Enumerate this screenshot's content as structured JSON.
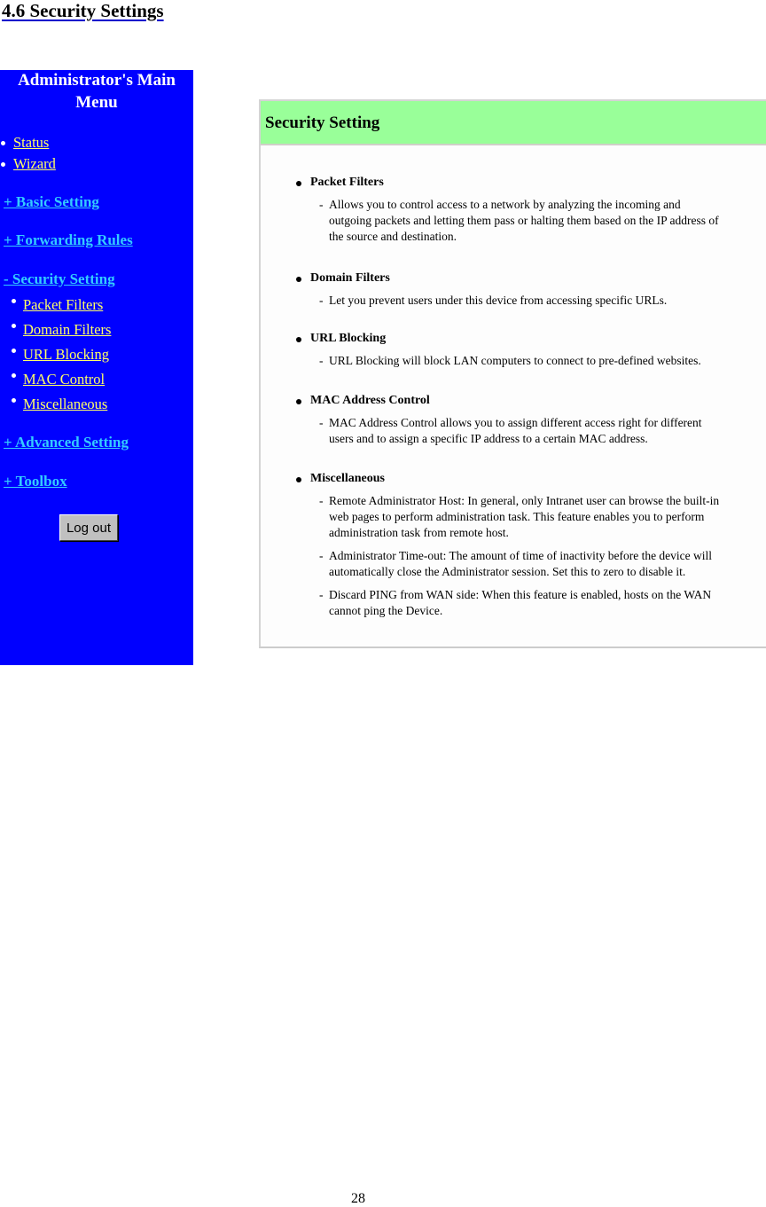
{
  "document": {
    "heading": "4.6 Security Settings",
    "page_number": "28"
  },
  "sidebar": {
    "title_line1": "Administrator's Main",
    "title_line2": "Menu",
    "top_links": [
      {
        "label": "Status"
      },
      {
        "label": "Wizard"
      }
    ],
    "groups": [
      {
        "label": "+ Basic Setting"
      },
      {
        "label": "+ Forwarding Rules"
      },
      {
        "label": "- Security Setting"
      },
      {
        "label": "+ Advanced Setting"
      },
      {
        "label": "+ Toolbox"
      }
    ],
    "security_sub_items": [
      {
        "label": "Packet Filters"
      },
      {
        "label": "Domain Filters"
      },
      {
        "label": "URL Blocking"
      },
      {
        "label": "MAC Control"
      },
      {
        "label": "Miscellaneous"
      }
    ],
    "logout_label": "Log out",
    "colors": {
      "background": "#0000ff",
      "group_link": "#33ccff",
      "sub_link": "#ffff66"
    }
  },
  "panel": {
    "title": "Security Setting",
    "header_color": "#99ff99",
    "items": [
      {
        "title": "Packet Filters",
        "descriptions": [
          [
            "Allows you to control access to a network by analyzing the incoming and",
            "outgoing packets and letting them pass or halting them based on the IP address of",
            "the source and destination."
          ]
        ]
      },
      {
        "title": "Domain Filters",
        "descriptions": [
          [
            "Let you prevent users under this device from accessing specific URLs."
          ]
        ]
      },
      {
        "title": "URL Blocking",
        "descriptions": [
          [
            "URL Blocking will block LAN computers to connect to pre-defined websites."
          ]
        ]
      },
      {
        "title": "MAC Address Control",
        "descriptions": [
          [
            "MAC Address Control allows you to assign different access right for different",
            "users and to assign a specific IP address to a certain MAC address."
          ]
        ]
      },
      {
        "title": "Miscellaneous",
        "descriptions": [
          [
            "Remote Administrator Host: In general, only Intranet user can browse the built-in",
            "web pages to perform administration task. This feature enables you to perform",
            "administration task from remote host."
          ],
          [
            "Administrator Time-out: The amount of time of inactivity before the device will",
            "automatically close the Administrator session. Set this to zero to disable it."
          ],
          [
            "Discard PING from WAN side: When this feature is enabled, hosts on the WAN",
            "cannot ping the Device."
          ]
        ]
      }
    ]
  }
}
